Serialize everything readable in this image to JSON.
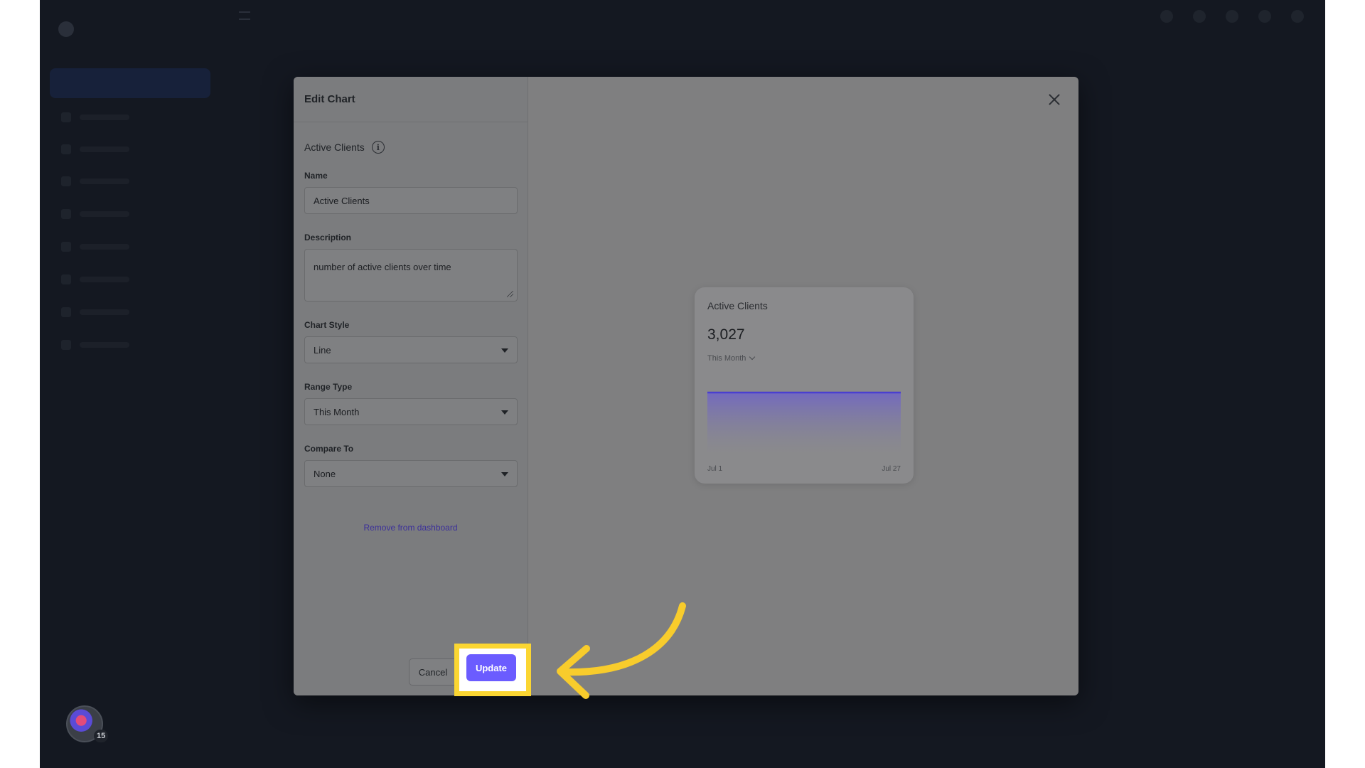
{
  "modal": {
    "title": "Edit Chart",
    "metric_title": "Active Clients",
    "info_glyph": "i",
    "fields": {
      "name_label": "Name",
      "name_value": "Active Clients",
      "description_label": "Description",
      "description_value": "number of active clients over time",
      "chart_style_label": "Chart Style",
      "chart_style_value": "Line",
      "range_type_label": "Range Type",
      "range_type_value": "This Month",
      "compare_to_label": "Compare To",
      "compare_to_value": "None"
    },
    "remove_link": "Remove from dashboard",
    "cancel_label": "Cancel",
    "update_label": "Update"
  },
  "preview": {
    "title": "Active Clients",
    "value": "3,027",
    "range": "This Month",
    "x_start": "Jul 1",
    "x_end": "Jul 27"
  },
  "chart_data": {
    "type": "area",
    "x": [
      "Jul 1",
      "Jul 27"
    ],
    "values": [
      3027,
      3027
    ]
  },
  "background": {
    "avatar_badge": "15"
  },
  "colors": {
    "accent": "#6b5cff",
    "highlight": "#fbd632",
    "link": "#3b2f9a",
    "chart_line": "#4a3fd0"
  },
  "icons": {
    "close": "close-icon",
    "info": "info-icon",
    "dropdown": "caret-down-icon",
    "arrow": "curved-arrow-icon"
  }
}
